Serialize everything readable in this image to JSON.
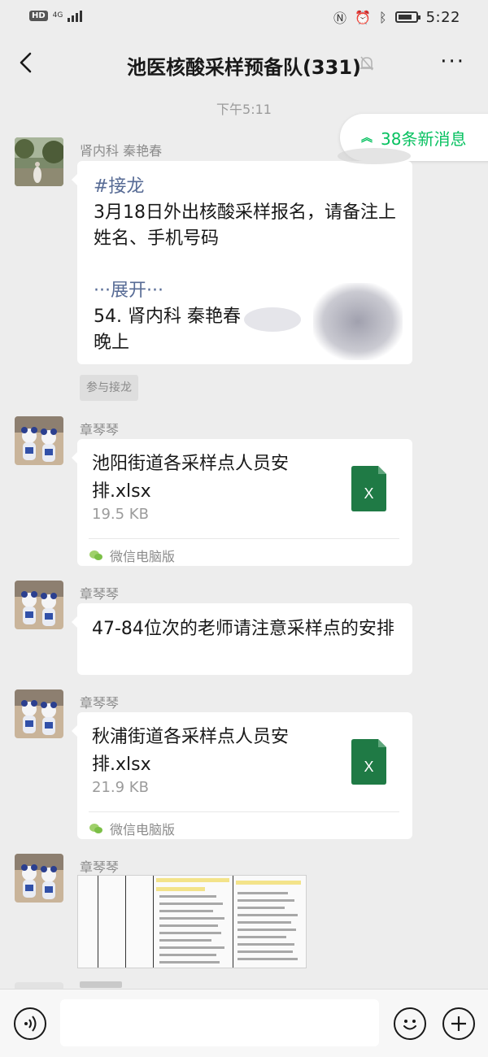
{
  "status_bar": {
    "hd_badge": "HD",
    "network": "4G",
    "time": "5:22"
  },
  "nav": {
    "title": "池医核酸采样预备队(331)",
    "more_label": "···"
  },
  "timestamp": "下午5:11",
  "new_messages": {
    "label": "38条新消息",
    "accent_color": "#07c160"
  },
  "messages": [
    {
      "type": "jielong",
      "sender": "肾内科 秦艳春",
      "tag": "#接龙",
      "body": "3月18日外出核酸采样报名，请备注上姓名、手机号码",
      "expand": "···展开···",
      "entry": "54. 肾内科 秦艳春",
      "entry_suffix": "晚上",
      "join_label": "参与接龙"
    },
    {
      "type": "file",
      "sender": "章琴琴",
      "file_name": "池阳街道各采样点人员安排.xlsx",
      "file_size": "19.5 KB",
      "source": "微信电脑版"
    },
    {
      "type": "text",
      "sender": "章琴琴",
      "text": "47-84位次的老师请注意采样点的安排"
    },
    {
      "type": "file",
      "sender": "章琴琴",
      "file_name": "秋浦街道各采样点人员安排.xlsx",
      "file_size": "21.9 KB",
      "source": "微信电脑版"
    },
    {
      "type": "image",
      "sender": "章琴琴"
    }
  ],
  "input_bar": {
    "voice_icon": "voice-icon",
    "emoji_icon": "emoji-icon",
    "plus_icon": "plus-icon"
  },
  "colors": {
    "background": "#ededed",
    "link": "#576b95",
    "excel_green": "#1f7a45"
  }
}
